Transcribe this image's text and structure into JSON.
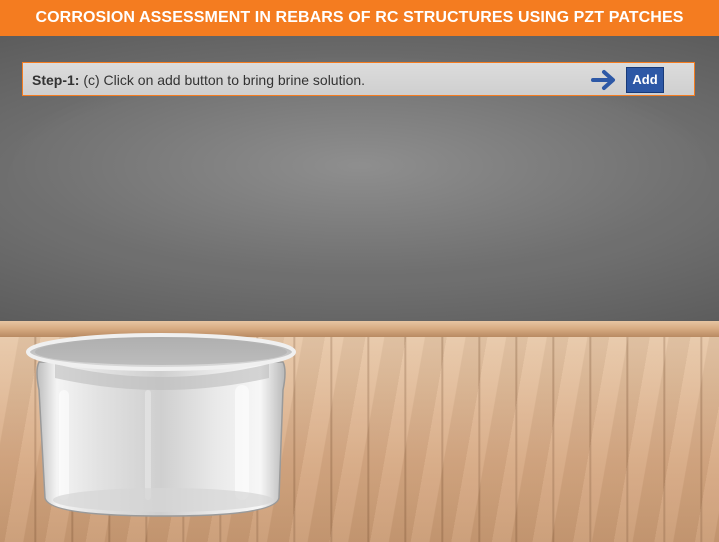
{
  "app": {
    "title": "CORROSION ASSESSMENT IN REBARS OF RC STRUCTURES USING PZT PATCHES"
  },
  "instruction": {
    "step_label": "Step-1:",
    "step_text": " (c) Click on add button to bring brine solution."
  },
  "toolbar": {
    "add_label": "Add",
    "arrow_icon": "arrow-right-icon"
  },
  "colors": {
    "header_bg": "#f47c20",
    "button_bg": "#2d58a6",
    "arrow": "#2d58a6"
  }
}
